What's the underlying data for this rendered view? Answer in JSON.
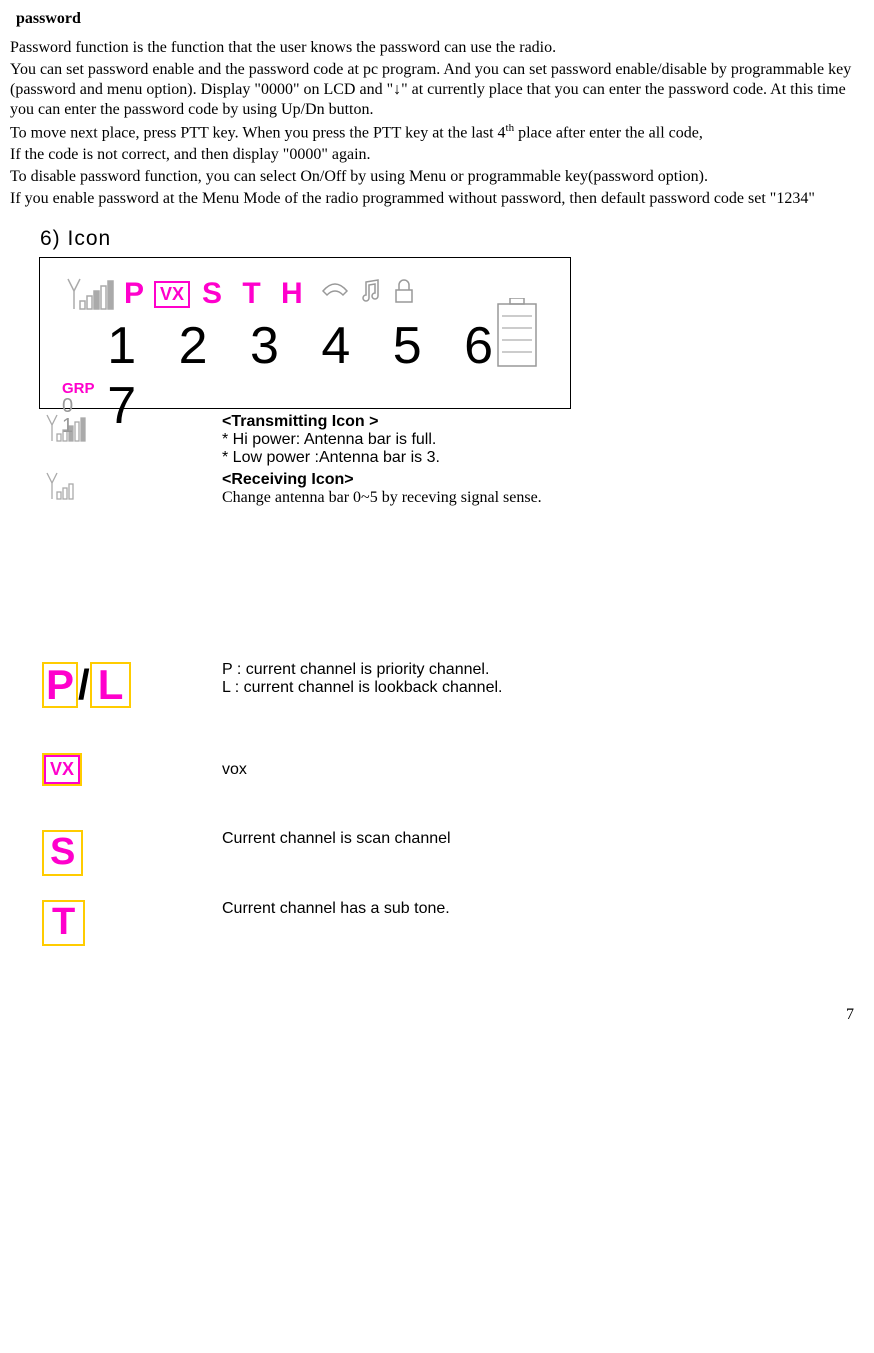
{
  "title": "password",
  "paragraphs": {
    "p1": "Password function is the function that the user knows the password can use the radio.",
    "p2": "You can set password enable and the password code at pc program. And you can set password enable/disable by programmable key (password and menu option). Display \"0000\" on LCD and \"↓\" at currently place that you can enter the password code. At this time you can enter the password code by using Up/Dn button.",
    "p3a": "To move next place, press PTT key. When you press the PTT key at the last 4",
    "p3sup": "th",
    "p3b": " place after enter the all code,",
    "p4": "If the code is not correct, and then display \"0000\" again.",
    "p5": "To disable password function, you can select On/Off by using Menu or programmable key(password option).",
    "p6": "If you enable password at the Menu Mode of the radio programmed without password, then default password code set \"1234\""
  },
  "section": "6) Icon",
  "lcd": {
    "p": "P",
    "vx": "VX",
    "sth": "S T H",
    "grp": "GRP",
    "grp_num": "0 1",
    "digits": "1 2 3 4 5 6 7"
  },
  "icons": {
    "tx_title": "<Transmitting Icon >",
    "tx_hi": "* Hi power: Antenna bar is full.",
    "tx_lo": "* Low power :Antenna bar is 3.",
    "rx_title": "<Receiving Icon>",
    "rx_desc": " Change antenna bar 0~5 by receving signal sense.",
    "pl_p": "P",
    "pl_slash": "/",
    "pl_l": "L",
    "pl_desc1": "P : current channel is priority channel.",
    "pl_desc2": "L : current channel is lookback channel.",
    "vx": "VX",
    "vx_desc": "vox",
    "s": "S",
    "s_desc": "Current channel is scan channel",
    "t": "T",
    "t_desc": "Current channel has a sub tone."
  },
  "page": "7"
}
